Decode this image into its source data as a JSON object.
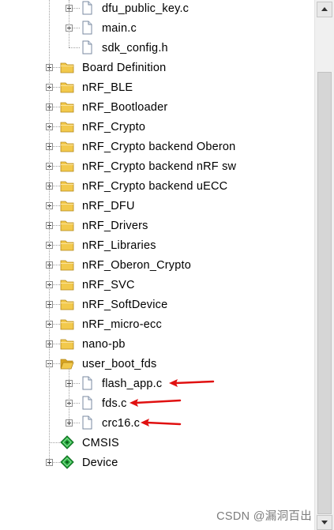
{
  "tree": {
    "items": [
      {
        "label": "dfu_public_key.c",
        "kind": "file",
        "expander": "plus",
        "level": 2
      },
      {
        "label": "main.c",
        "kind": "file",
        "expander": "plus",
        "level": 2
      },
      {
        "label": "sdk_config.h",
        "kind": "file",
        "expander": "none",
        "level": 2
      },
      {
        "label": "Board Definition",
        "kind": "folder",
        "expander": "plus",
        "level": 1
      },
      {
        "label": "nRF_BLE",
        "kind": "folder",
        "expander": "plus",
        "level": 1
      },
      {
        "label": "nRF_Bootloader",
        "kind": "folder",
        "expander": "plus",
        "level": 1
      },
      {
        "label": "nRF_Crypto",
        "kind": "folder",
        "expander": "plus",
        "level": 1
      },
      {
        "label": "nRF_Crypto backend Oberon",
        "kind": "folder",
        "expander": "plus",
        "level": 1
      },
      {
        "label": "nRF_Crypto backend nRF sw",
        "kind": "folder",
        "expander": "plus",
        "level": 1
      },
      {
        "label": "nRF_Crypto backend uECC",
        "kind": "folder",
        "expander": "plus",
        "level": 1
      },
      {
        "label": "nRF_DFU",
        "kind": "folder",
        "expander": "plus",
        "level": 1
      },
      {
        "label": "nRF_Drivers",
        "kind": "folder",
        "expander": "plus",
        "level": 1
      },
      {
        "label": "nRF_Libraries",
        "kind": "folder",
        "expander": "plus",
        "level": 1
      },
      {
        "label": "nRF_Oberon_Crypto",
        "kind": "folder",
        "expander": "plus",
        "level": 1
      },
      {
        "label": "nRF_SVC",
        "kind": "folder",
        "expander": "plus",
        "level": 1
      },
      {
        "label": "nRF_SoftDevice",
        "kind": "folder",
        "expander": "plus",
        "level": 1
      },
      {
        "label": "nRF_micro-ecc",
        "kind": "folder",
        "expander": "plus",
        "level": 1
      },
      {
        "label": "nano-pb",
        "kind": "folder",
        "expander": "plus",
        "level": 1
      },
      {
        "label": "user_boot_fds",
        "kind": "folder-open",
        "expander": "minus",
        "level": 1
      },
      {
        "label": "flash_app.c",
        "kind": "file",
        "expander": "plus",
        "level": 2,
        "annotated": true
      },
      {
        "label": "fds.c",
        "kind": "file",
        "expander": "plus",
        "level": 2,
        "annotated": true
      },
      {
        "label": "crc16.c",
        "kind": "file",
        "expander": "plus",
        "level": 2,
        "annotated": true
      },
      {
        "label": "CMSIS",
        "kind": "component",
        "expander": "none",
        "level": 1
      },
      {
        "label": "Device",
        "kind": "component",
        "expander": "plus",
        "level": 1
      }
    ]
  },
  "watermark": "CSDN @漏洞百出",
  "colors": {
    "folder": "#f2c94c",
    "folder_dark": "#d9a520",
    "file_bg": "#ffffff",
    "component": "#22a83a",
    "annotation_arrow": "#e01010"
  }
}
